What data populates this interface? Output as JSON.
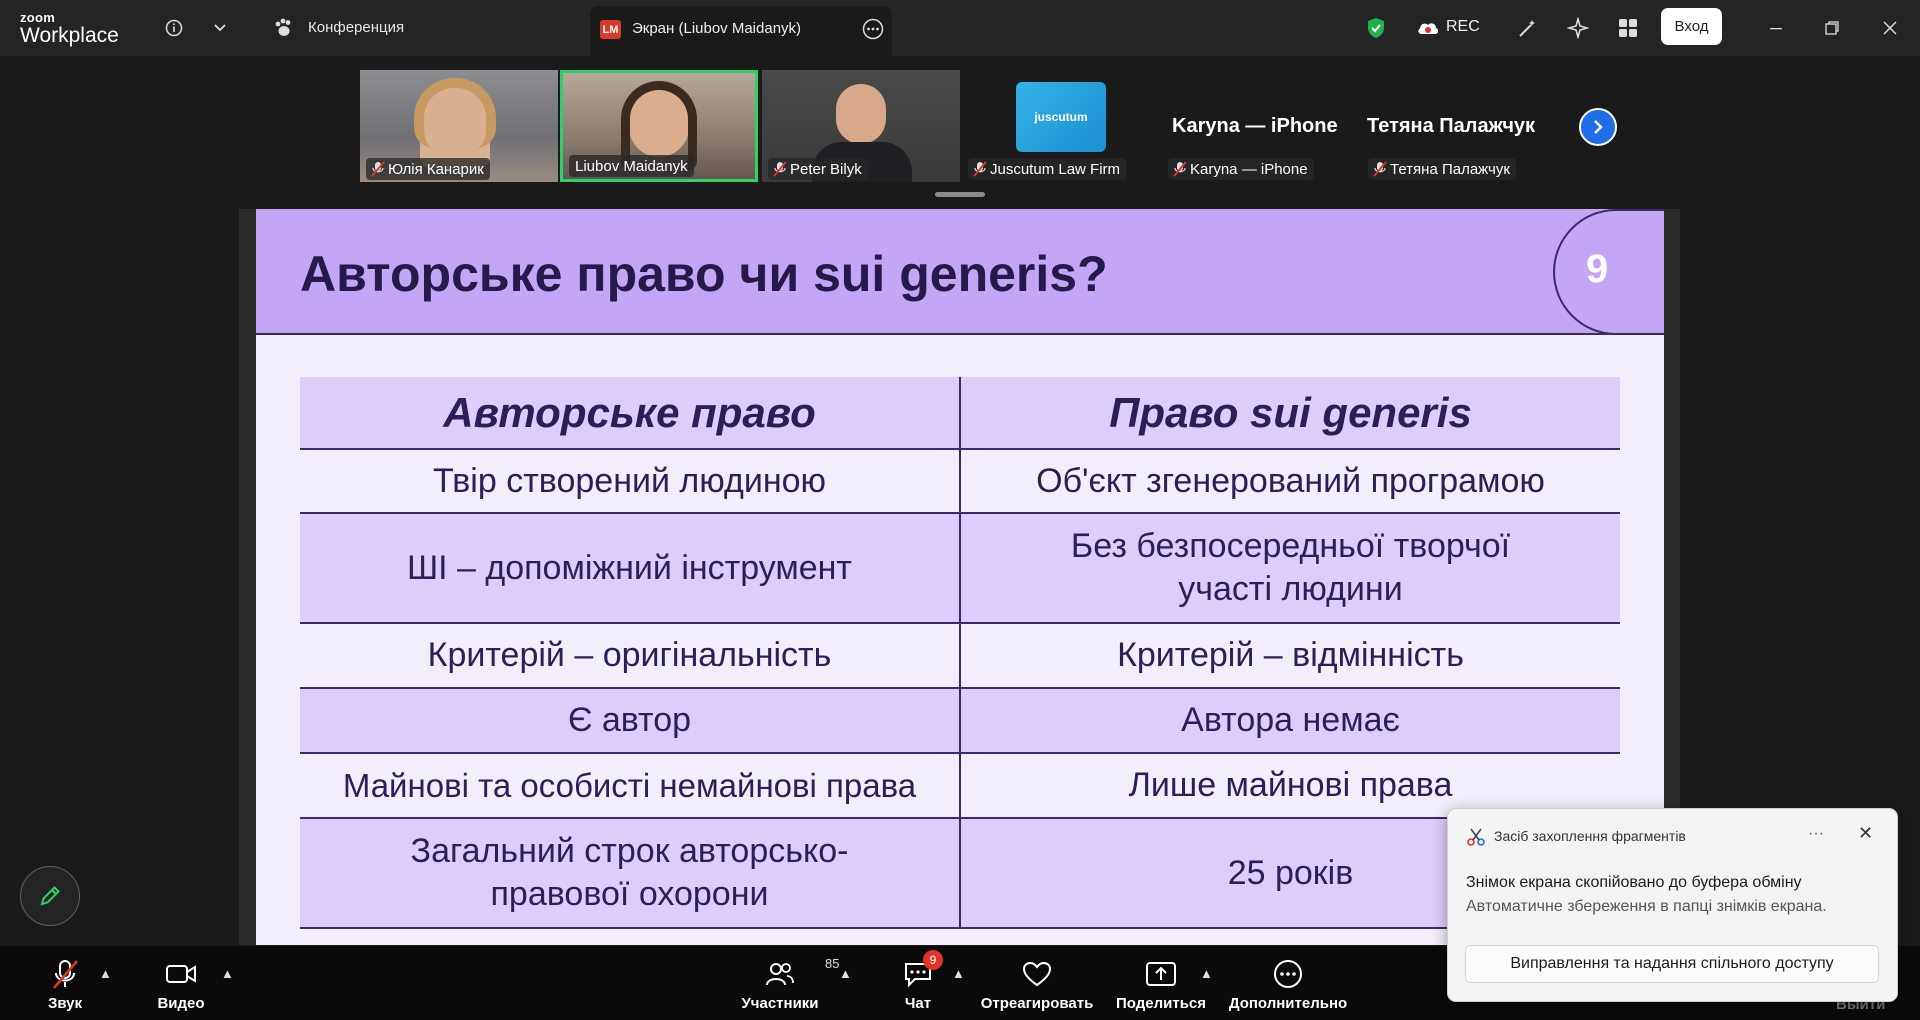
{
  "app": {
    "logo_top": "zoom",
    "logo_bottom": "Workplace"
  },
  "topbar": {
    "conference_label": "Конференция",
    "share_tab_label": "Экран (Liubov Maidanyk)",
    "share_tab_badge": "LM",
    "rec_label": "REC",
    "signin_label": "Вход"
  },
  "participants": [
    {
      "name": "Юлія Канарик"
    },
    {
      "name": "Liubov Maidanyk"
    },
    {
      "name": "Peter Bilyk"
    },
    {
      "name": "Juscutum Law Firm",
      "logo_text": "juscutum"
    },
    {
      "name": "Karyna — iPhone",
      "display": "Karyna — iPhone"
    },
    {
      "name": "Тетяна Палажчук",
      "display": "Тетяна Палажчук"
    }
  ],
  "slide": {
    "title": "Авторське право чи sui generis?",
    "page_number": "9",
    "table": {
      "headers": [
        "Авторське право",
        "Право sui generis"
      ],
      "rows": [
        [
          "Твір створений людиною",
          "Об'єкт згенерований програмою"
        ],
        [
          "ШІ – допоміжний інструмент",
          "Без безпосередньої творчої участі людини"
        ],
        [
          "Критерій – оригінальність",
          "Критерій – відмінність"
        ],
        [
          "Є автор",
          "Автора немає"
        ],
        [
          "Майнові та особисті немайнові права",
          "Лише майнові права"
        ],
        [
          "Загальний строк авторсько-правової охорони",
          "25 років"
        ]
      ]
    }
  },
  "toolbar": {
    "audio": "Звук",
    "video": "Видео",
    "participants": "Участники",
    "participants_count": "85",
    "chat": "Чат",
    "chat_badge": "9",
    "react": "Отреагировать",
    "share": "Поделиться",
    "more": "Дополнительно",
    "leave": "Выйти"
  },
  "toast": {
    "app_name": "Засіб захоплення фрагментів",
    "message": "Знімок екрана скопійовано до буфера обміну",
    "sub": "Автоматичне збереження в папці знімків екрана.",
    "action": "Виправлення та надання спільного доступу",
    "dots": "···",
    "close": "✕"
  },
  "colors": {
    "slide_header": "#c3a6f5",
    "slide_row": "#dccdfb",
    "slide_text": "#2c1f58",
    "active_speaker": "#2fd06b",
    "shield": "#1fb24c",
    "next_button": "#1f6ee6"
  }
}
